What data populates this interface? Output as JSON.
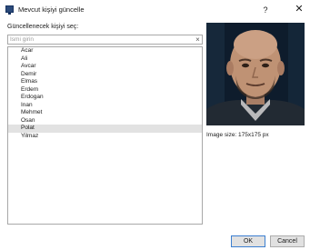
{
  "window": {
    "title": "Mevcut kişiyi güncelle",
    "help_label": "?",
    "close_label": "✕"
  },
  "prompt_label": "Güncellenecek kişiyi seç:",
  "search": {
    "placeholder": "İsmi girin",
    "value": "",
    "clear_label": "×"
  },
  "people": [
    "Acar",
    "Ali",
    "Avcar",
    "Demir",
    "Elmas",
    "Erdem",
    "Erdogan",
    "Inan",
    "Mehmet",
    "Osan",
    "Polat",
    "Yilmaz"
  ],
  "selected_person": "Polat",
  "image_size_label": "Image size: 175x175 px",
  "buttons": {
    "ok_label": "OK",
    "cancel_label": "Cancel"
  },
  "colors": {
    "selection": "#e2e2e2",
    "accent": "#3c7fd0"
  }
}
